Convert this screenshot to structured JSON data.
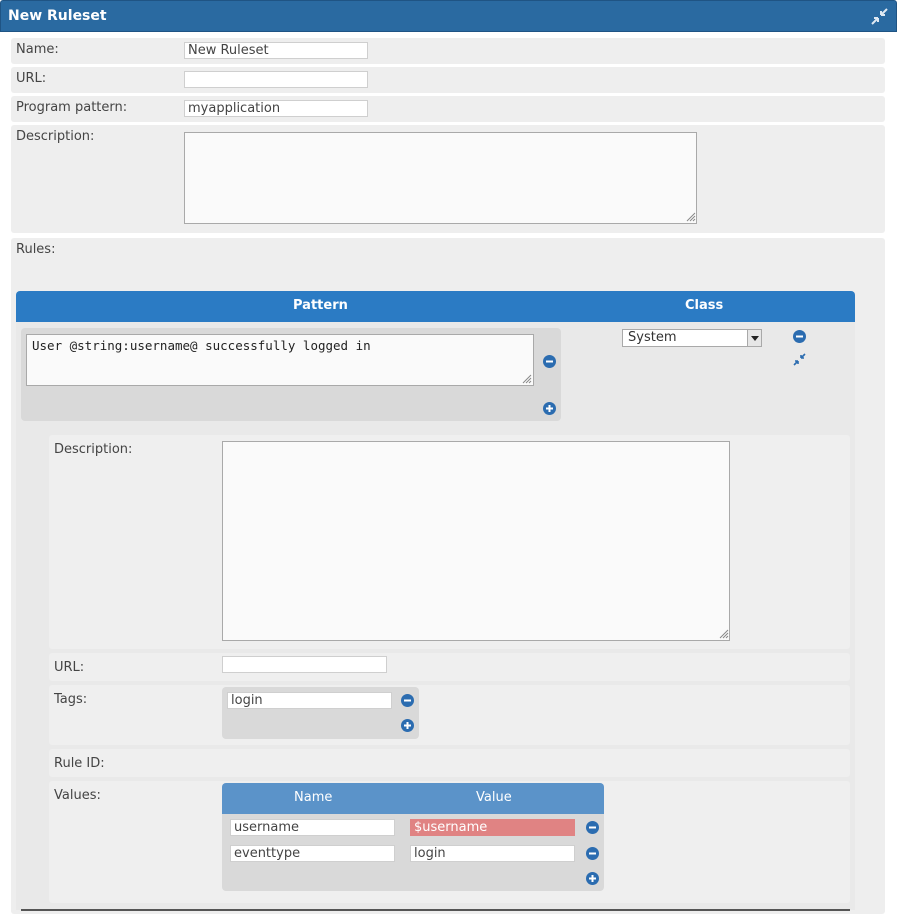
{
  "window": {
    "title": "New Ruleset",
    "collapse_icon": "collapse-arrows-icon"
  },
  "ruleset": {
    "name_label": "Name:",
    "name_value": "New Ruleset",
    "url_label": "URL:",
    "url_value": "",
    "program_label": "Program pattern:",
    "program_value": "myapplication",
    "description_label": "Description:",
    "description_value": "",
    "rules_label": "Rules:"
  },
  "rules_table": {
    "columns": [
      "Pattern",
      "Class"
    ],
    "rule": {
      "pattern": "User @string:username@ successfully logged in",
      "class_value": "System",
      "description_label": "Description:",
      "description_value": "",
      "url_label": "URL:",
      "url_value": "",
      "tags_label": "Tags:",
      "tags": [
        "login"
      ],
      "rule_id_label": "Rule ID:",
      "values_label": "Values:",
      "values_columns": [
        "Name",
        "Value"
      ],
      "values": [
        {
          "name": "username",
          "value": "$username",
          "error": true
        },
        {
          "name": "eventtype",
          "value": "login",
          "error": false
        }
      ]
    }
  },
  "colors": {
    "title_bar": "#2a6aa1",
    "table_header": "#2b7bc4",
    "values_header": "#5b93c9",
    "icon_blue": "#2b6cb0",
    "error_value": "#e08383"
  }
}
